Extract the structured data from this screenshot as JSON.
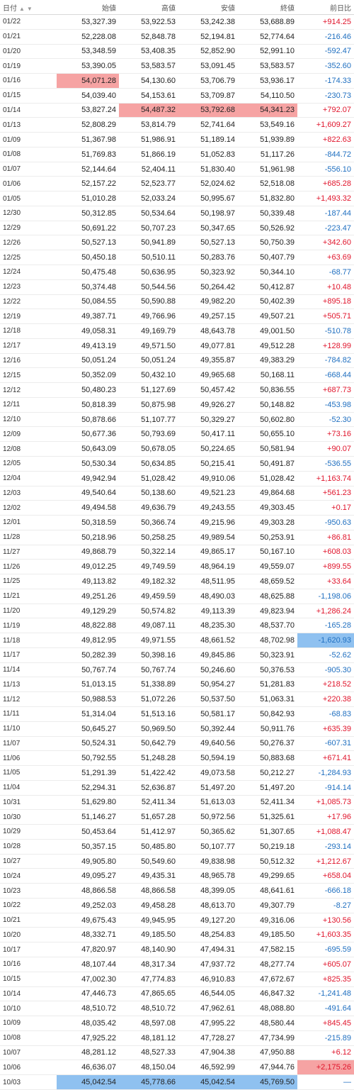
{
  "headers": {
    "date": "日付",
    "open": "始値",
    "high": "高値",
    "low": "安値",
    "close": "終値",
    "change": "前日比"
  },
  "sort_icons": [
    "▲",
    "▼"
  ],
  "rows": [
    [
      "01/22",
      "53,327.39",
      "53,922.53",
      "53,242.38",
      "53,688.89",
      "+914.25"
    ],
    [
      "01/21",
      "52,228.08",
      "52,848.78",
      "52,194.81",
      "52,774.64",
      "-216.46"
    ],
    [
      "01/20",
      "53,348.59",
      "53,408.35",
      "52,852.90",
      "52,991.10",
      "-592.47"
    ],
    [
      "01/19",
      "53,390.05",
      "53,583.57",
      "53,091.45",
      "53,583.57",
      "-352.60"
    ],
    [
      "01/16",
      "54,071.28",
      "54,130.60",
      "53,706.79",
      "53,936.17",
      "-174.33"
    ],
    [
      "01/15",
      "54,039.40",
      "54,153.61",
      "53,709.87",
      "54,110.50",
      "-230.73"
    ],
    [
      "01/14",
      "53,827.24",
      "54,487.32",
      "53,792.68",
      "54,341.23",
      "+792.07"
    ],
    [
      "01/13",
      "52,808.29",
      "53,814.79",
      "52,741.64",
      "53,549.16",
      "+1,609.27"
    ],
    [
      "01/09",
      "51,367.98",
      "51,986.91",
      "51,189.14",
      "51,939.89",
      "+822.63"
    ],
    [
      "01/08",
      "51,769.83",
      "51,866.19",
      "51,052.83",
      "51,117.26",
      "-844.72"
    ],
    [
      "01/07",
      "52,144.64",
      "52,404.11",
      "51,830.40",
      "51,961.98",
      "-556.10"
    ],
    [
      "01/06",
      "52,157.22",
      "52,523.77",
      "52,024.62",
      "52,518.08",
      "+685.28"
    ],
    [
      "01/05",
      "51,010.28",
      "52,033.24",
      "50,995.67",
      "51,832.80",
      "+1,493.32"
    ],
    [
      "12/30",
      "50,312.85",
      "50,534.64",
      "50,198.97",
      "50,339.48",
      "-187.44"
    ],
    [
      "12/29",
      "50,691.22",
      "50,707.23",
      "50,347.65",
      "50,526.92",
      "-223.47"
    ],
    [
      "12/26",
      "50,527.13",
      "50,941.89",
      "50,527.13",
      "50,750.39",
      "+342.60"
    ],
    [
      "12/25",
      "50,450.18",
      "50,510.11",
      "50,283.76",
      "50,407.79",
      "+63.69"
    ],
    [
      "12/24",
      "50,475.48",
      "50,636.95",
      "50,323.92",
      "50,344.10",
      "-68.77"
    ],
    [
      "12/23",
      "50,374.48",
      "50,544.56",
      "50,264.42",
      "50,412.87",
      "+10.48"
    ],
    [
      "12/22",
      "50,084.55",
      "50,590.88",
      "49,982.20",
      "50,402.39",
      "+895.18"
    ],
    [
      "12/19",
      "49,387.71",
      "49,766.96",
      "49,257.15",
      "49,507.21",
      "+505.71"
    ],
    [
      "12/18",
      "49,058.31",
      "49,169.79",
      "48,643.78",
      "49,001.50",
      "-510.78"
    ],
    [
      "12/17",
      "49,413.19",
      "49,571.50",
      "49,077.81",
      "49,512.28",
      "+128.99"
    ],
    [
      "12/16",
      "50,051.24",
      "50,051.24",
      "49,355.87",
      "49,383.29",
      "-784.82"
    ],
    [
      "12/15",
      "50,352.09",
      "50,432.10",
      "49,965.68",
      "50,168.11",
      "-668.44"
    ],
    [
      "12/12",
      "50,480.23",
      "51,127.69",
      "50,457.42",
      "50,836.55",
      "+687.73"
    ],
    [
      "12/11",
      "50,818.39",
      "50,875.98",
      "49,926.27",
      "50,148.82",
      "-453.98"
    ],
    [
      "12/10",
      "50,878.66",
      "51,107.77",
      "50,329.27",
      "50,602.80",
      "-52.30"
    ],
    [
      "12/09",
      "50,677.36",
      "50,793.69",
      "50,417.11",
      "50,655.10",
      "+73.16"
    ],
    [
      "12/08",
      "50,643.09",
      "50,678.05",
      "50,224.65",
      "50,581.94",
      "+90.07"
    ],
    [
      "12/05",
      "50,530.34",
      "50,634.85",
      "50,215.41",
      "50,491.87",
      "-536.55"
    ],
    [
      "12/04",
      "49,942.94",
      "51,028.42",
      "49,910.06",
      "51,028.42",
      "+1,163.74"
    ],
    [
      "12/03",
      "49,540.64",
      "50,138.60",
      "49,521.23",
      "49,864.68",
      "+561.23"
    ],
    [
      "12/02",
      "49,494.58",
      "49,636.79",
      "49,243.55",
      "49,303.45",
      "+0.17"
    ],
    [
      "12/01",
      "50,318.59",
      "50,366.74",
      "49,215.96",
      "49,303.28",
      "-950.63"
    ],
    [
      "11/28",
      "50,218.96",
      "50,258.25",
      "49,989.54",
      "50,253.91",
      "+86.81"
    ],
    [
      "11/27",
      "49,868.79",
      "50,322.14",
      "49,865.17",
      "50,167.10",
      "+608.03"
    ],
    [
      "11/26",
      "49,012.25",
      "49,749.59",
      "48,964.19",
      "49,559.07",
      "+899.55"
    ],
    [
      "11/25",
      "49,113.82",
      "49,182.32",
      "48,511.95",
      "48,659.52",
      "+33.64"
    ],
    [
      "11/21",
      "49,251.26",
      "49,459.59",
      "48,490.03",
      "48,625.88",
      "-1,198.06"
    ],
    [
      "11/20",
      "49,129.29",
      "50,574.82",
      "49,113.39",
      "49,823.94",
      "+1,286.24"
    ],
    [
      "11/19",
      "48,822.88",
      "49,087.11",
      "48,235.30",
      "48,537.70",
      "-165.28"
    ],
    [
      "11/18",
      "49,812.95",
      "49,971.55",
      "48,661.52",
      "48,702.98",
      "-1,620.93"
    ],
    [
      "11/17",
      "50,282.39",
      "50,398.16",
      "49,845.86",
      "50,323.91",
      "-52.62"
    ],
    [
      "11/14",
      "50,767.74",
      "50,767.74",
      "50,246.60",
      "50,376.53",
      "-905.30"
    ],
    [
      "11/13",
      "51,013.15",
      "51,338.89",
      "50,954.27",
      "51,281.83",
      "+218.52"
    ],
    [
      "11/12",
      "50,988.53",
      "51,072.26",
      "50,537.50",
      "51,063.31",
      "+220.38"
    ],
    [
      "11/11",
      "51,314.04",
      "51,513.16",
      "50,581.17",
      "50,842.93",
      "-68.83"
    ],
    [
      "11/10",
      "50,645.27",
      "50,969.50",
      "50,392.44",
      "50,911.76",
      "+635.39"
    ],
    [
      "11/07",
      "50,524.31",
      "50,642.79",
      "49,640.56",
      "50,276.37",
      "-607.31"
    ],
    [
      "11/06",
      "50,792.55",
      "51,248.28",
      "50,594.19",
      "50,883.68",
      "+671.41"
    ],
    [
      "11/05",
      "51,291.39",
      "51,422.42",
      "49,073.58",
      "50,212.27",
      "-1,284.93"
    ],
    [
      "11/04",
      "52,294.31",
      "52,636.87",
      "51,497.20",
      "51,497.20",
      "-914.14"
    ],
    [
      "10/31",
      "51,629.80",
      "52,411.34",
      "51,613.03",
      "52,411.34",
      "+1,085.73"
    ],
    [
      "10/30",
      "51,146.27",
      "51,657.28",
      "50,972.56",
      "51,325.61",
      "+17.96"
    ],
    [
      "10/29",
      "50,453.64",
      "51,412.97",
      "50,365.62",
      "51,307.65",
      "+1,088.47"
    ],
    [
      "10/28",
      "50,357.15",
      "50,485.80",
      "50,107.77",
      "50,219.18",
      "-293.14"
    ],
    [
      "10/27",
      "49,905.80",
      "50,549.60",
      "49,838.98",
      "50,512.32",
      "+1,212.67"
    ],
    [
      "10/24",
      "49,095.27",
      "49,435.31",
      "48,965.78",
      "49,299.65",
      "+658.04"
    ],
    [
      "10/23",
      "48,866.58",
      "48,866.58",
      "48,399.05",
      "48,641.61",
      "-666.18"
    ],
    [
      "10/22",
      "49,252.03",
      "49,458.28",
      "48,613.70",
      "49,307.79",
      "-8.27"
    ],
    [
      "10/21",
      "49,675.43",
      "49,945.95",
      "49,127.20",
      "49,316.06",
      "+130.56"
    ],
    [
      "10/20",
      "48,332.71",
      "49,185.50",
      "48,254.83",
      "49,185.50",
      "+1,603.35"
    ],
    [
      "10/17",
      "47,820.97",
      "48,140.90",
      "47,494.31",
      "47,582.15",
      "-695.59"
    ],
    [
      "10/16",
      "48,107.44",
      "48,317.34",
      "47,937.72",
      "48,277.74",
      "+605.07"
    ],
    [
      "10/15",
      "47,002.30",
      "47,774.83",
      "46,910.83",
      "47,672.67",
      "+825.35"
    ],
    [
      "10/14",
      "47,446.73",
      "47,865.65",
      "46,544.05",
      "46,847.32",
      "-1,241.48"
    ],
    [
      "10/10",
      "48,510.72",
      "48,510.72",
      "47,962.61",
      "48,088.80",
      "-491.64"
    ],
    [
      "10/09",
      "48,035.42",
      "48,597.08",
      "47,995.22",
      "48,580.44",
      "+845.45"
    ],
    [
      "10/08",
      "47,925.22",
      "48,181.12",
      "47,728.27",
      "47,734.99",
      "-215.89"
    ],
    [
      "10/07",
      "48,281.12",
      "48,527.33",
      "47,904.38",
      "47,950.88",
      "+6.12"
    ],
    [
      "10/06",
      "46,636.07",
      "48,150.04",
      "46,592.99",
      "47,944.76",
      "+2,175.26"
    ],
    [
      "10/03",
      "45,042.54",
      "45,778.66",
      "45,042.54",
      "45,769.50",
      "—"
    ]
  ],
  "highlights": {
    "red": [
      [
        4,
        1
      ],
      [
        6,
        2
      ],
      [
        6,
        3
      ],
      [
        6,
        4
      ],
      [
        71,
        5
      ]
    ],
    "blue": [
      [
        42,
        5
      ],
      [
        72,
        1
      ],
      [
        72,
        2
      ],
      [
        72,
        3
      ],
      [
        72,
        4
      ]
    ]
  },
  "colors": {
    "up": "#e0142b",
    "down": "#1f6fc0",
    "highlight_red": "#f6a3a3",
    "highlight_blue": "#8fc1f0"
  }
}
